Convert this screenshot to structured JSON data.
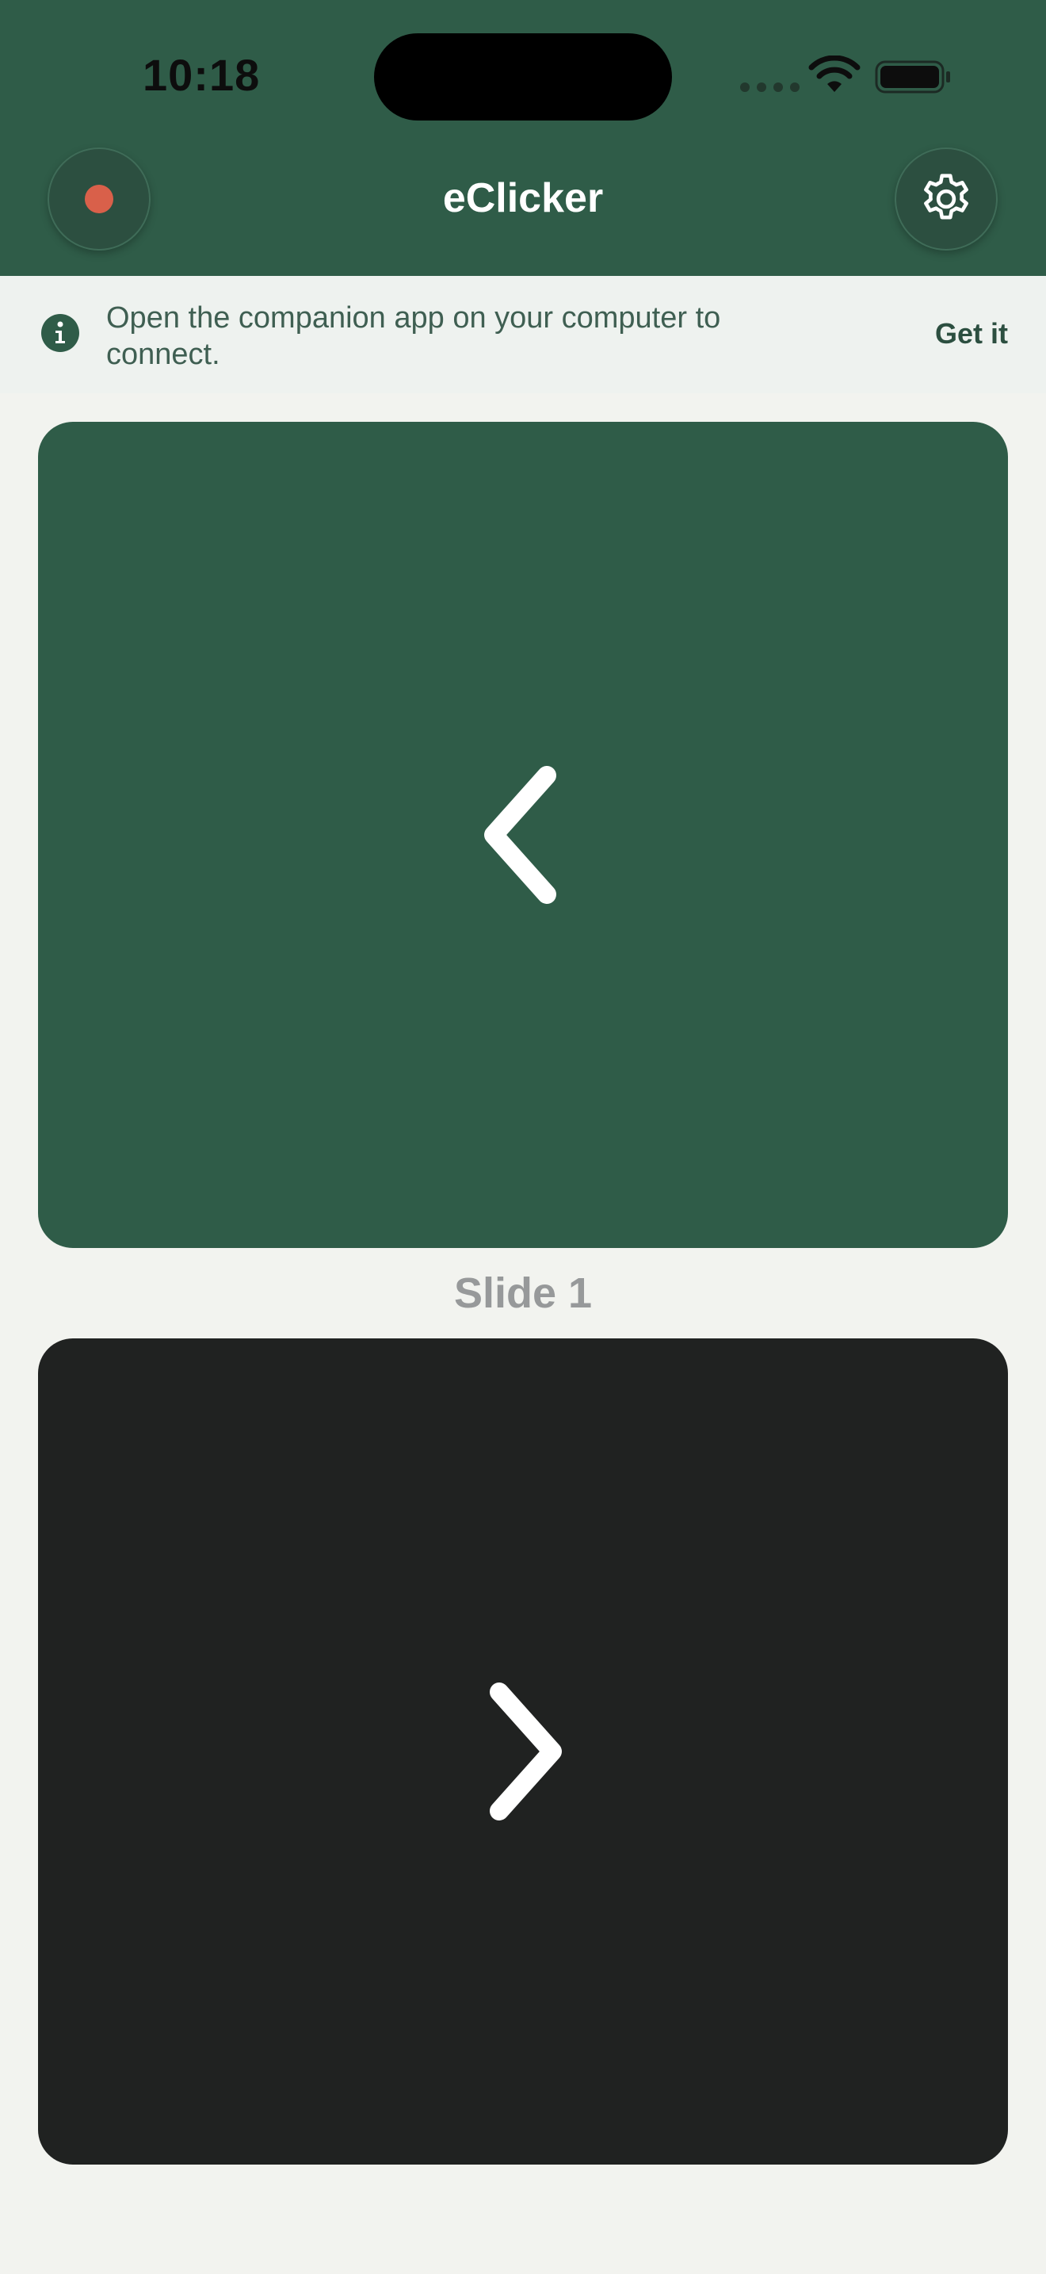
{
  "status_bar": {
    "time": "10:18"
  },
  "header": {
    "title": "eClicker",
    "record_icon": "record-dot-icon",
    "settings_icon": "gear-icon"
  },
  "banner": {
    "message": "Open the companion app on your computer to connect.",
    "action_label": "Get it",
    "icon": "info-icon"
  },
  "panels": {
    "previous_icon": "chevron-left-icon",
    "next_icon": "chevron-right-icon"
  },
  "slide": {
    "label": "Slide 1"
  },
  "colors": {
    "header_bg": "#2f5c48",
    "prev_panel_bg": "#2f5c48",
    "next_panel_bg": "#202221",
    "record_dot": "#d9604a",
    "page_bg": "#f2f3ef"
  }
}
